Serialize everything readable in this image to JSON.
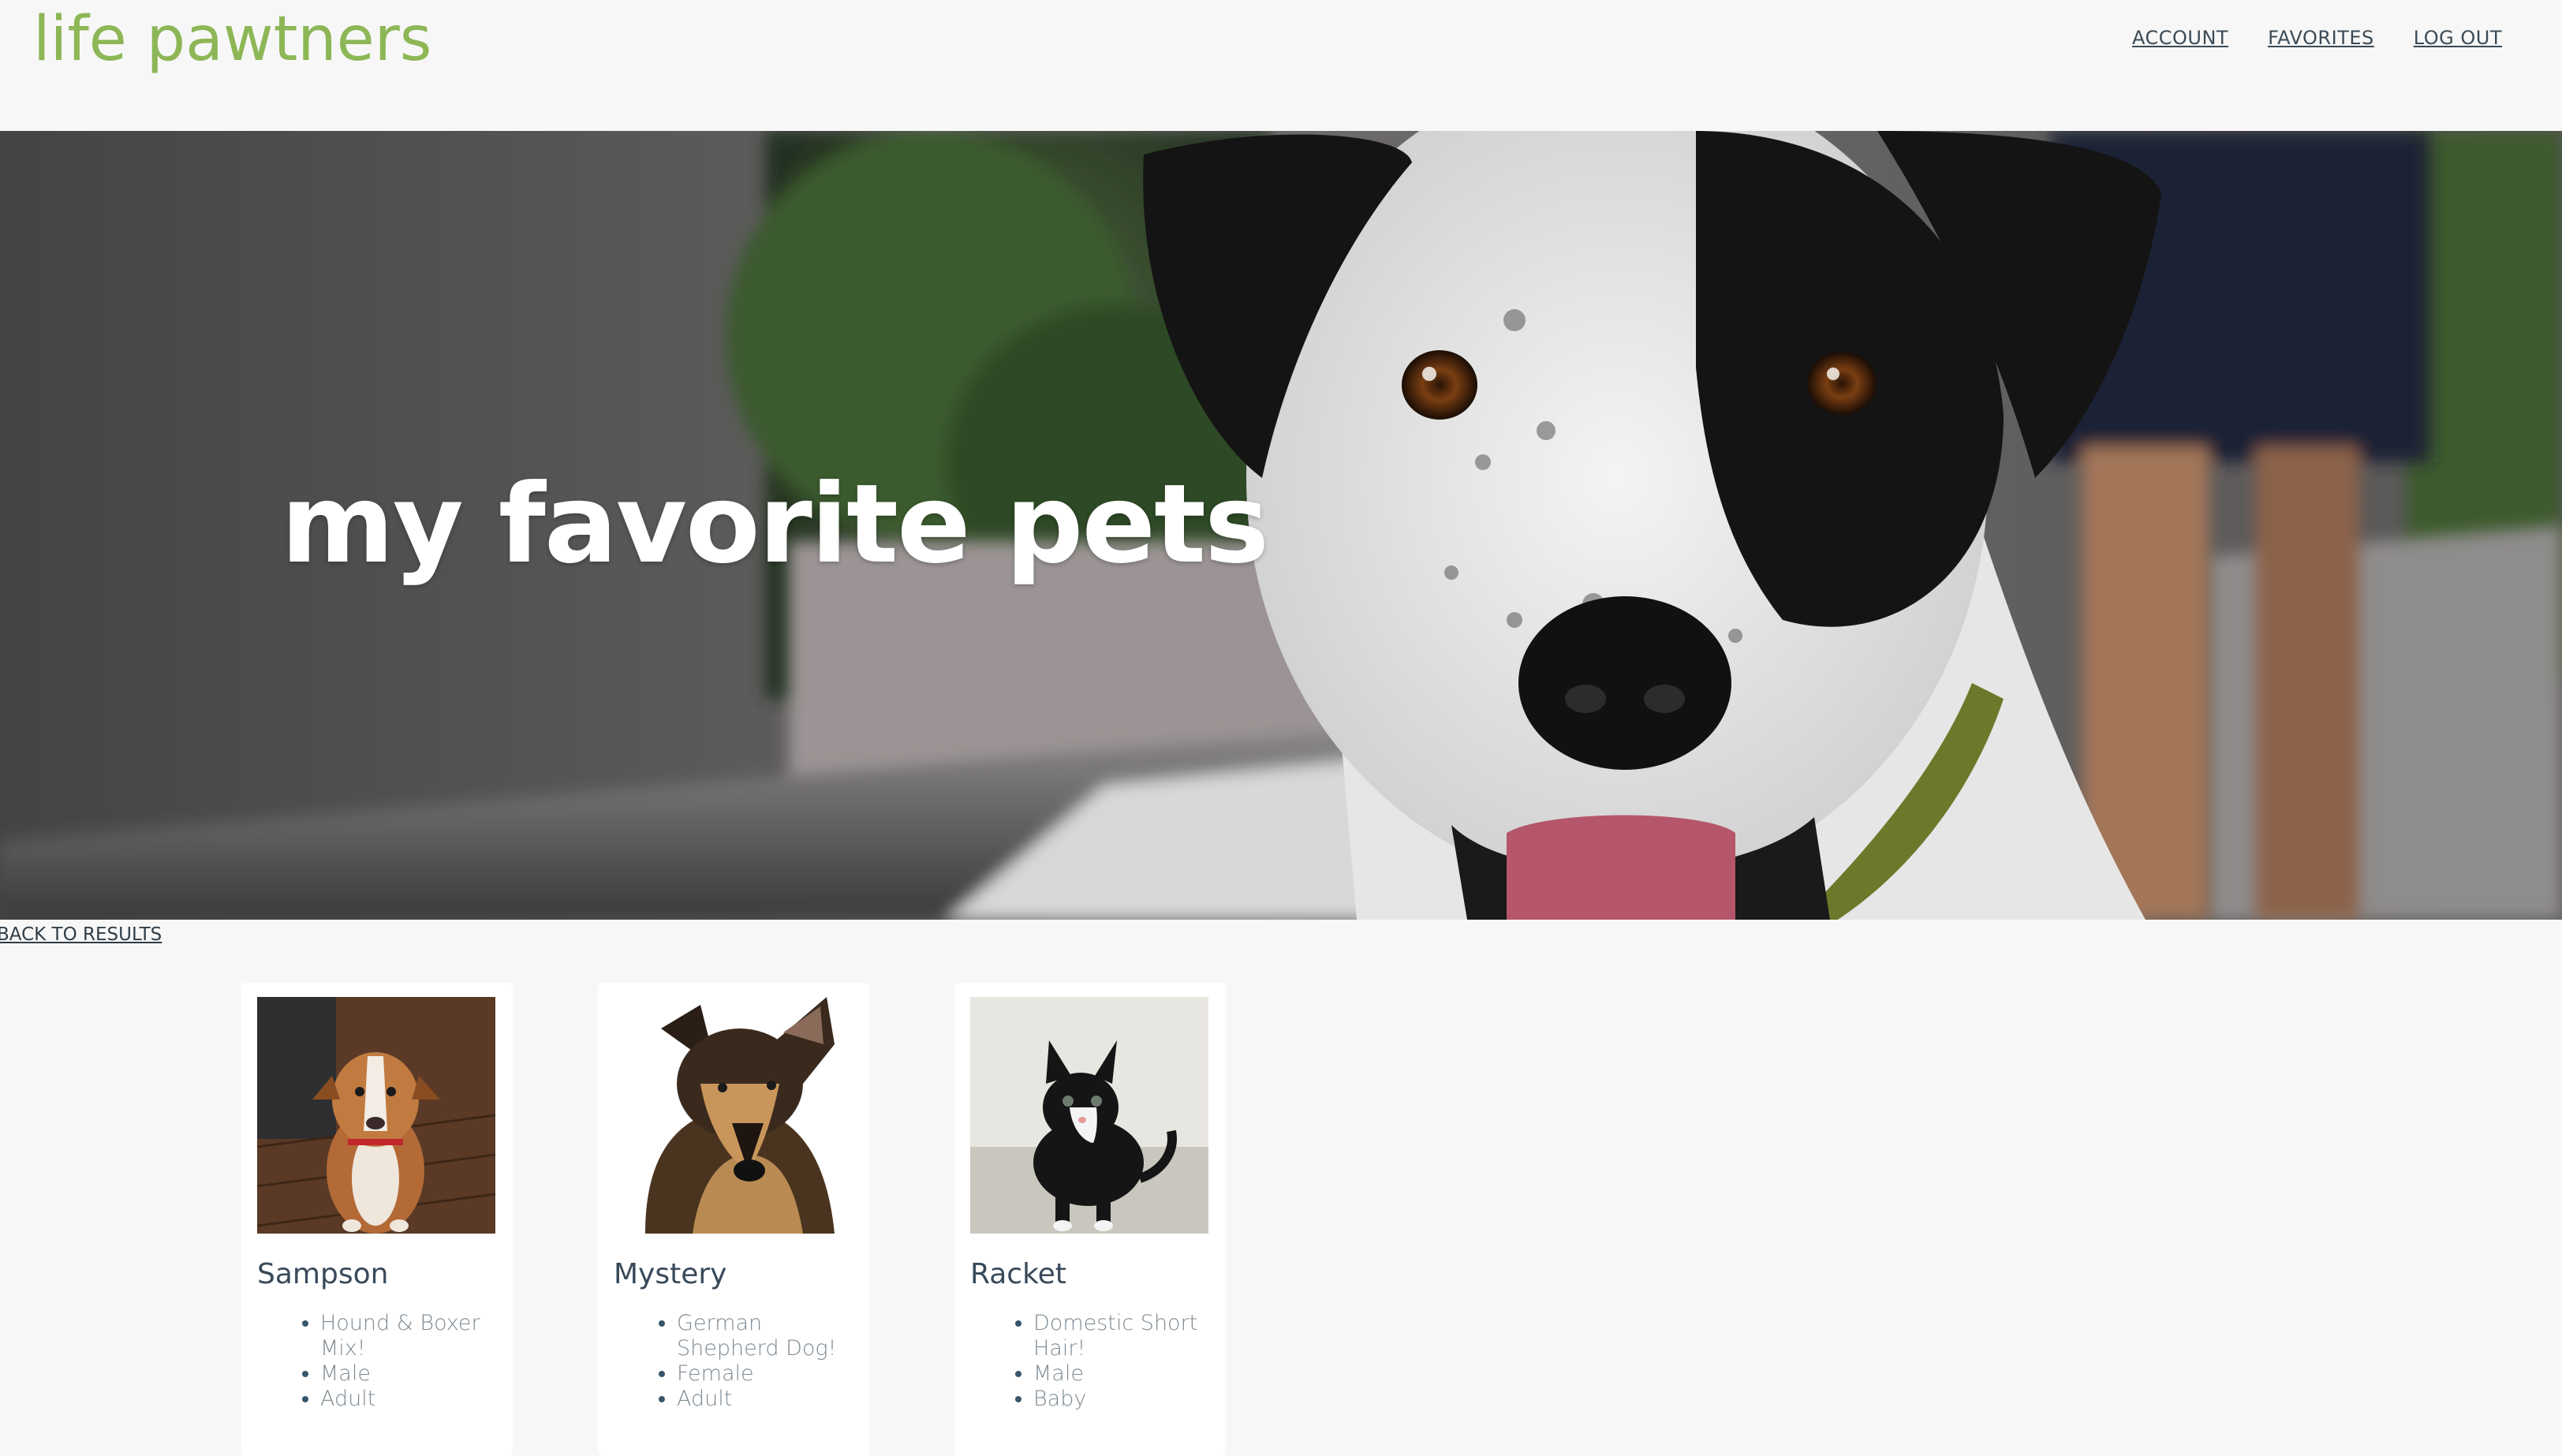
{
  "header": {
    "brand": "life pawtners",
    "nav": {
      "account": "ACCOUNT",
      "favorites": "FAVORITES",
      "logout": "LOG OUT"
    }
  },
  "hero": {
    "title": "my favorite pets"
  },
  "back_link": "BACK TO RESULTS",
  "pets": [
    {
      "name": "Sampson",
      "facts": [
        "Hound & Boxer Mix!",
        "Male",
        "Adult"
      ]
    },
    {
      "name": "Mystery",
      "facts": [
        "German Shepherd Dog!",
        "Female",
        "Adult"
      ]
    },
    {
      "name": "Racket",
      "facts": [
        "Domestic Short Hair!",
        "Male",
        "Baby"
      ]
    }
  ],
  "colors": {
    "brand": "#8db756",
    "background": "#f7f7f7",
    "nav_text": "#3b4b57"
  }
}
